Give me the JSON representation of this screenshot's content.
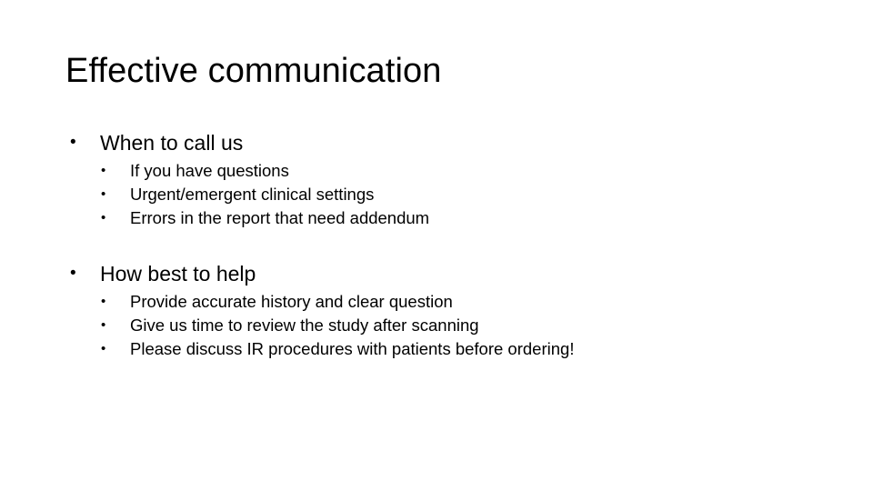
{
  "slide": {
    "title": "Effective communication",
    "background_color": "#ffffff",
    "text_color": "#000000",
    "bullet_glyph": "•",
    "groups": [
      {
        "heading": "When to call us",
        "items": [
          "If you have questions",
          "Urgent/emergent clinical settings",
          "Errors in the report that need addendum"
        ]
      },
      {
        "heading": "How best to help",
        "items": [
          "Provide accurate history and clear question",
          "Give us time to review the study after scanning",
          "Please discuss IR procedures with patients before ordering!"
        ]
      }
    ]
  }
}
